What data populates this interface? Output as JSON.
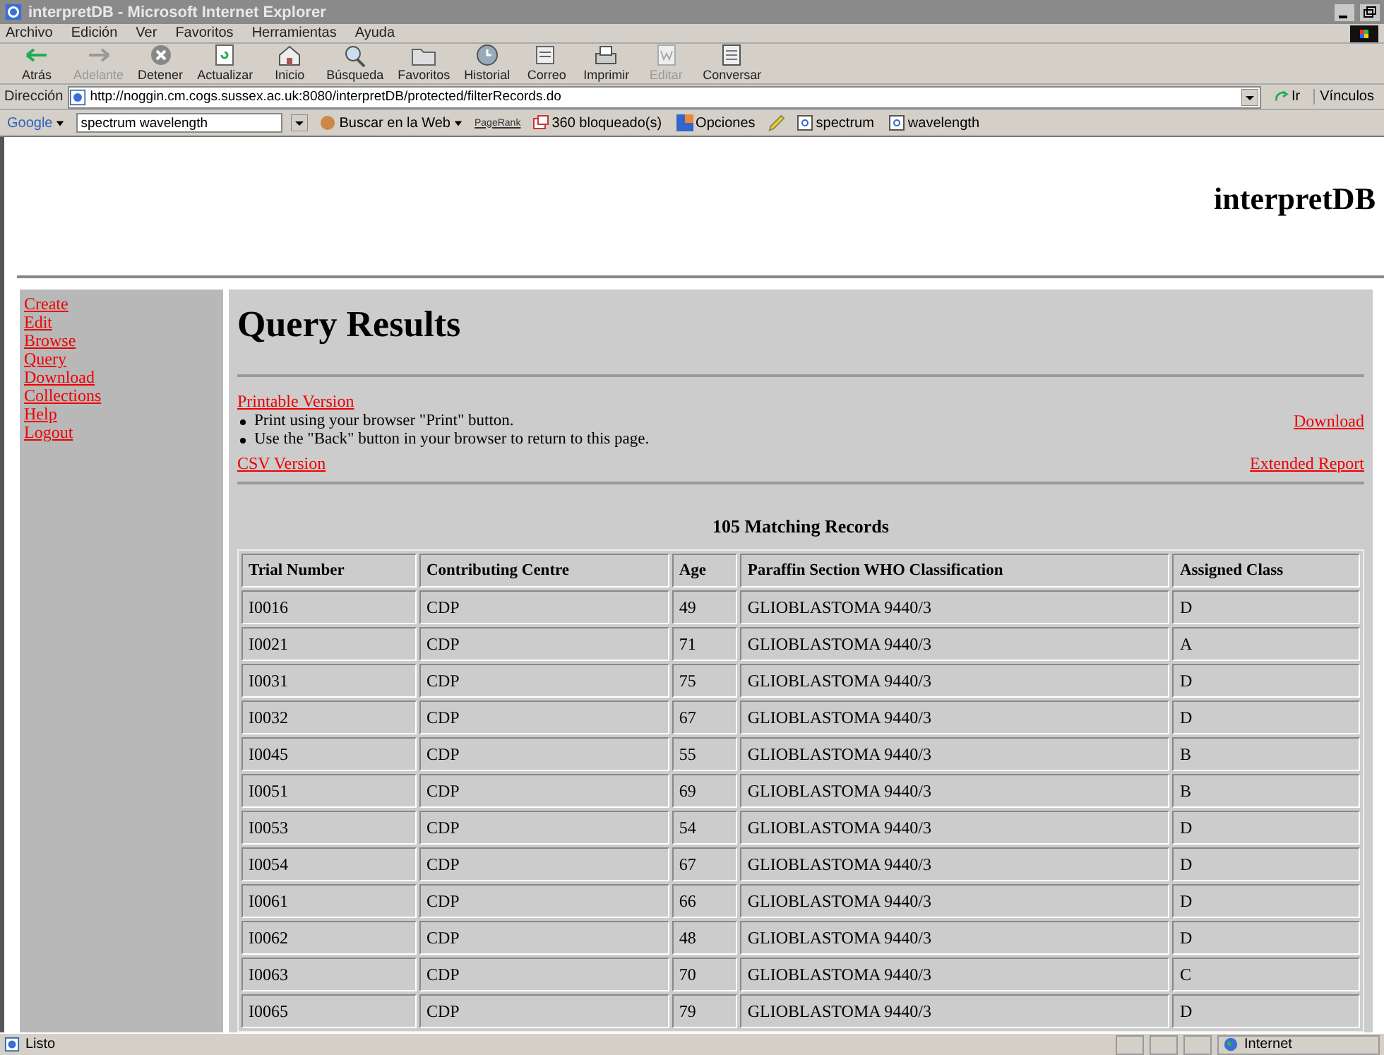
{
  "window": {
    "title": "interpretDB - Microsoft Internet Explorer"
  },
  "menu": [
    "Archivo",
    "Edición",
    "Ver",
    "Favoritos",
    "Herramientas",
    "Ayuda"
  ],
  "toolbar": [
    {
      "label": "Atrás",
      "kind": "back",
      "disabled": false
    },
    {
      "label": "Adelante",
      "kind": "forward",
      "disabled": true
    },
    {
      "label": "Detener",
      "kind": "stop",
      "disabled": false
    },
    {
      "label": "Actualizar",
      "kind": "refresh",
      "disabled": false
    },
    {
      "label": "Inicio",
      "kind": "home",
      "disabled": false
    },
    {
      "label": "Búsqueda",
      "kind": "search",
      "disabled": false
    },
    {
      "label": "Favoritos",
      "kind": "folder",
      "disabled": false
    },
    {
      "label": "Historial",
      "kind": "history",
      "disabled": false
    },
    {
      "label": "Correo",
      "kind": "mail",
      "disabled": false
    },
    {
      "label": "Imprimir",
      "kind": "print",
      "disabled": false
    },
    {
      "label": "Editar",
      "kind": "edit",
      "disabled": true
    },
    {
      "label": "Conversar",
      "kind": "discuss",
      "disabled": false
    }
  ],
  "address_bar": {
    "label": "Dirección",
    "value": "http://noggin.cm.cogs.sussex.ac.uk:8080/interpretDB/protected/filterRecords.do",
    "go": "Ir",
    "links": "Vínculos"
  },
  "google_bar": {
    "logo": "Google",
    "search_value": "spectrum wavelength",
    "search_button": "Buscar en la Web",
    "pagerank": "PageRank",
    "blocked": "360 bloqueado(s)",
    "options": "Opciones",
    "terms": [
      "spectrum",
      "wavelength"
    ]
  },
  "page": {
    "site_title": "interpretDB",
    "sidebar": {
      "items": [
        {
          "label": "Create"
        },
        {
          "label": "Edit"
        },
        {
          "label": "Browse"
        },
        {
          "label": "Query"
        },
        {
          "label": "Download"
        },
        {
          "label": "Collections"
        },
        {
          "label": "Help"
        },
        {
          "label": "Logout"
        }
      ]
    },
    "heading": "Query Results",
    "printable_link": "Printable Version",
    "instructions": [
      "Print using your browser \"Print\" button.",
      "Use the \"Back\" button in your browser to return to this page."
    ],
    "download_link": "Download",
    "csv_link": "CSV Version",
    "extended_link": "Extended Report",
    "count": "105 Matching Records",
    "table": {
      "columns": [
        "Trial Number",
        "Contributing Centre",
        "Age",
        "Paraffin Section WHO Classification",
        "Assigned Class"
      ],
      "rows": [
        [
          "I0016",
          "CDP",
          "49",
          "GLIOBLASTOMA 9440/3",
          "D"
        ],
        [
          "I0021",
          "CDP",
          "71",
          "GLIOBLASTOMA 9440/3",
          "A"
        ],
        [
          "I0031",
          "CDP",
          "75",
          "GLIOBLASTOMA 9440/3",
          "D"
        ],
        [
          "I0032",
          "CDP",
          "67",
          "GLIOBLASTOMA 9440/3",
          "D"
        ],
        [
          "I0045",
          "CDP",
          "55",
          "GLIOBLASTOMA 9440/3",
          "B"
        ],
        [
          "I0051",
          "CDP",
          "69",
          "GLIOBLASTOMA 9440/3",
          "B"
        ],
        [
          "I0053",
          "CDP",
          "54",
          "GLIOBLASTOMA 9440/3",
          "D"
        ],
        [
          "I0054",
          "CDP",
          "67",
          "GLIOBLASTOMA 9440/3",
          "D"
        ],
        [
          "I0061",
          "CDP",
          "66",
          "GLIOBLASTOMA 9440/3",
          "D"
        ],
        [
          "I0062",
          "CDP",
          "48",
          "GLIOBLASTOMA 9440/3",
          "D"
        ],
        [
          "I0063",
          "CDP",
          "70",
          "GLIOBLASTOMA 9440/3",
          "C"
        ],
        [
          "I0065",
          "CDP",
          "79",
          "GLIOBLASTOMA 9440/3",
          "D"
        ]
      ]
    }
  },
  "status_bar": {
    "text": "Listo",
    "zone": "Internet"
  }
}
